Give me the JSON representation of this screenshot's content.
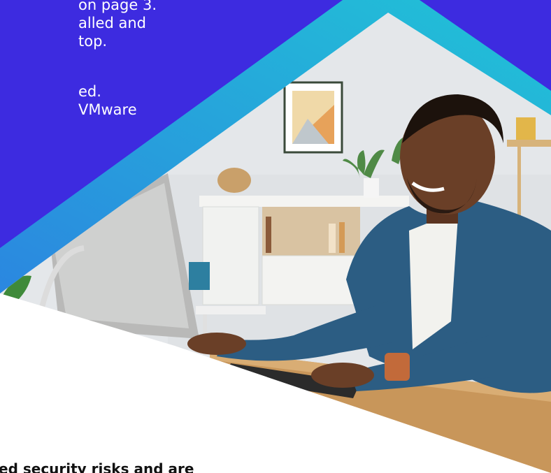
{
  "top_text_lines": [
    "on page 3.",
    "alled and",
    "top.",
    "",
    "ed.",
    "VMware"
  ],
  "bottom_text": "ed security risks and are",
  "colors": {
    "blue_purple": "#3d2be0",
    "cyan_band_light": "#21c3d6",
    "cyan_band_dark": "#2b86e0",
    "wall": "#e6e9ec",
    "desk": "#c8965a",
    "shirt": "#2c5d83"
  },
  "icons": {
    "photo": "man-at-computer-photo"
  }
}
